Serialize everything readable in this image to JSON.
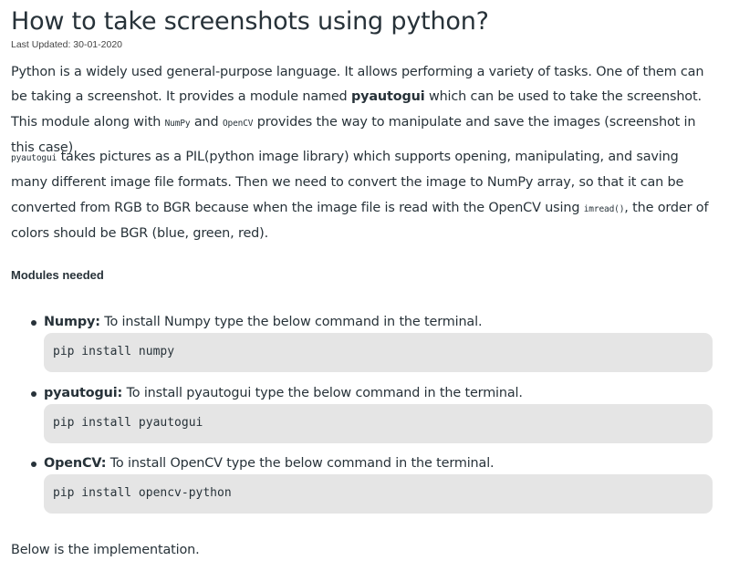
{
  "article": {
    "title": "How to take screenshots using python?",
    "last_updated": "Last Updated: 30-01-2020",
    "paragraph1": {
      "text_a": "Python is a widely used general-purpose language. It allows performing a variety of tasks. One of them can be taking a screenshot. It provides a module named ",
      "bold_module": "pyautogui",
      "text_b": " which can be used to take the screenshot. This module along with ",
      "code_numpy": "NumPy",
      "text_c": " and ",
      "code_opencv": "OpenCV",
      "text_d": " provides the way to manipulate and save the images (screenshot in this case)"
    },
    "paragraph2": {
      "code_pyautogui": "pyautogui",
      "text_a": " takes pictures as a PIL(python image library) which supports opening, manipulating, and saving many different image file formats. Then we need to convert the image to NumPy array, so that it can be converted from RGB to BGR because when the image file is read with the OpenCV using ",
      "code_imread": "imread()",
      "text_b": ", the order of colors should be BGR (blue, green, red)."
    },
    "modules_heading": "Modules needed",
    "modules": [
      {
        "name": "Numpy:",
        "description": " To install Numpy type the below command in the terminal.",
        "command": "pip install numpy"
      },
      {
        "name": "pyautogui:",
        "description": " To install pyautogui type the below command in the terminal.",
        "command": "pip install pyautogui"
      },
      {
        "name": "OpenCV:",
        "description": " To install OpenCV type the below command in the terminal.",
        "command": "pip install opencv-python"
      }
    ],
    "closing": "Below is the implementation."
  }
}
